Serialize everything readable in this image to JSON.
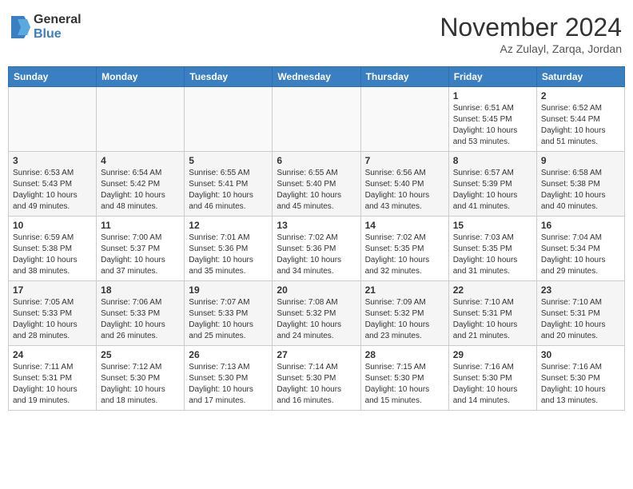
{
  "header": {
    "logo_general": "General",
    "logo_blue": "Blue",
    "month_title": "November 2024",
    "location": "Az Zulayl, Zarqa, Jordan"
  },
  "calendar": {
    "weekdays": [
      "Sunday",
      "Monday",
      "Tuesday",
      "Wednesday",
      "Thursday",
      "Friday",
      "Saturday"
    ],
    "rows": [
      [
        {
          "day": "",
          "info": ""
        },
        {
          "day": "",
          "info": ""
        },
        {
          "day": "",
          "info": ""
        },
        {
          "day": "",
          "info": ""
        },
        {
          "day": "",
          "info": ""
        },
        {
          "day": "1",
          "info": "Sunrise: 6:51 AM\nSunset: 5:45 PM\nDaylight: 10 hours and 53 minutes."
        },
        {
          "day": "2",
          "info": "Sunrise: 6:52 AM\nSunset: 5:44 PM\nDaylight: 10 hours and 51 minutes."
        }
      ],
      [
        {
          "day": "3",
          "info": "Sunrise: 6:53 AM\nSunset: 5:43 PM\nDaylight: 10 hours and 49 minutes."
        },
        {
          "day": "4",
          "info": "Sunrise: 6:54 AM\nSunset: 5:42 PM\nDaylight: 10 hours and 48 minutes."
        },
        {
          "day": "5",
          "info": "Sunrise: 6:55 AM\nSunset: 5:41 PM\nDaylight: 10 hours and 46 minutes."
        },
        {
          "day": "6",
          "info": "Sunrise: 6:55 AM\nSunset: 5:40 PM\nDaylight: 10 hours and 45 minutes."
        },
        {
          "day": "7",
          "info": "Sunrise: 6:56 AM\nSunset: 5:40 PM\nDaylight: 10 hours and 43 minutes."
        },
        {
          "day": "8",
          "info": "Sunrise: 6:57 AM\nSunset: 5:39 PM\nDaylight: 10 hours and 41 minutes."
        },
        {
          "day": "9",
          "info": "Sunrise: 6:58 AM\nSunset: 5:38 PM\nDaylight: 10 hours and 40 minutes."
        }
      ],
      [
        {
          "day": "10",
          "info": "Sunrise: 6:59 AM\nSunset: 5:38 PM\nDaylight: 10 hours and 38 minutes."
        },
        {
          "day": "11",
          "info": "Sunrise: 7:00 AM\nSunset: 5:37 PM\nDaylight: 10 hours and 37 minutes."
        },
        {
          "day": "12",
          "info": "Sunrise: 7:01 AM\nSunset: 5:36 PM\nDaylight: 10 hours and 35 minutes."
        },
        {
          "day": "13",
          "info": "Sunrise: 7:02 AM\nSunset: 5:36 PM\nDaylight: 10 hours and 34 minutes."
        },
        {
          "day": "14",
          "info": "Sunrise: 7:02 AM\nSunset: 5:35 PM\nDaylight: 10 hours and 32 minutes."
        },
        {
          "day": "15",
          "info": "Sunrise: 7:03 AM\nSunset: 5:35 PM\nDaylight: 10 hours and 31 minutes."
        },
        {
          "day": "16",
          "info": "Sunrise: 7:04 AM\nSunset: 5:34 PM\nDaylight: 10 hours and 29 minutes."
        }
      ],
      [
        {
          "day": "17",
          "info": "Sunrise: 7:05 AM\nSunset: 5:33 PM\nDaylight: 10 hours and 28 minutes."
        },
        {
          "day": "18",
          "info": "Sunrise: 7:06 AM\nSunset: 5:33 PM\nDaylight: 10 hours and 26 minutes."
        },
        {
          "day": "19",
          "info": "Sunrise: 7:07 AM\nSunset: 5:33 PM\nDaylight: 10 hours and 25 minutes."
        },
        {
          "day": "20",
          "info": "Sunrise: 7:08 AM\nSunset: 5:32 PM\nDaylight: 10 hours and 24 minutes."
        },
        {
          "day": "21",
          "info": "Sunrise: 7:09 AM\nSunset: 5:32 PM\nDaylight: 10 hours and 23 minutes."
        },
        {
          "day": "22",
          "info": "Sunrise: 7:10 AM\nSunset: 5:31 PM\nDaylight: 10 hours and 21 minutes."
        },
        {
          "day": "23",
          "info": "Sunrise: 7:10 AM\nSunset: 5:31 PM\nDaylight: 10 hours and 20 minutes."
        }
      ],
      [
        {
          "day": "24",
          "info": "Sunrise: 7:11 AM\nSunset: 5:31 PM\nDaylight: 10 hours and 19 minutes."
        },
        {
          "day": "25",
          "info": "Sunrise: 7:12 AM\nSunset: 5:30 PM\nDaylight: 10 hours and 18 minutes."
        },
        {
          "day": "26",
          "info": "Sunrise: 7:13 AM\nSunset: 5:30 PM\nDaylight: 10 hours and 17 minutes."
        },
        {
          "day": "27",
          "info": "Sunrise: 7:14 AM\nSunset: 5:30 PM\nDaylight: 10 hours and 16 minutes."
        },
        {
          "day": "28",
          "info": "Sunrise: 7:15 AM\nSunset: 5:30 PM\nDaylight: 10 hours and 15 minutes."
        },
        {
          "day": "29",
          "info": "Sunrise: 7:16 AM\nSunset: 5:30 PM\nDaylight: 10 hours and 14 minutes."
        },
        {
          "day": "30",
          "info": "Sunrise: 7:16 AM\nSunset: 5:30 PM\nDaylight: 10 hours and 13 minutes."
        }
      ]
    ]
  }
}
